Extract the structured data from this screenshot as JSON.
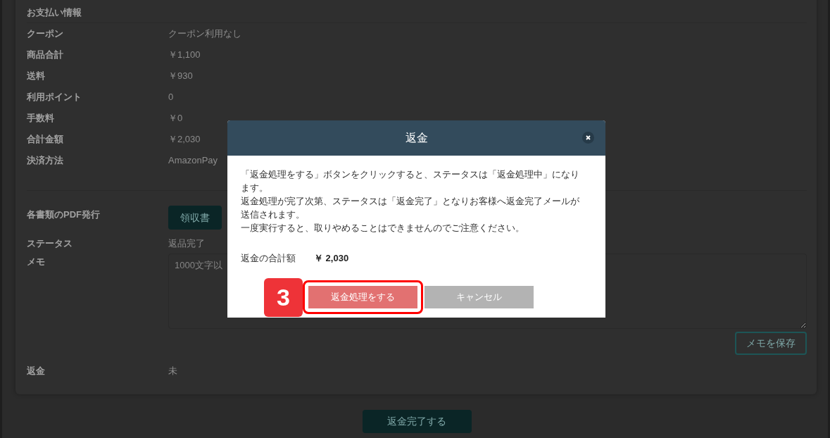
{
  "payment": {
    "title": "お支払い情報",
    "rows": [
      {
        "label": "クーポン",
        "value": "クーポン利用なし"
      },
      {
        "label": "商品合計",
        "value": "￥1,100"
      },
      {
        "label": "送料",
        "value": "￥930"
      },
      {
        "label": "利用ポイント",
        "value": "0"
      },
      {
        "label": "手数料",
        "value": "￥0"
      },
      {
        "label": "合計金額",
        "value": "￥2,030"
      },
      {
        "label": "決済方法",
        "value": "AmazonPay"
      }
    ]
  },
  "pdf": {
    "label": "各書類のPDF発行",
    "buttons": [
      "領収書"
    ]
  },
  "status": {
    "label": "ステータス",
    "value": "返品完了"
  },
  "memo": {
    "label": "メモ",
    "placeholder": "1000文字以",
    "save_button": "メモを保存"
  },
  "refund": {
    "label": "返金",
    "value": "未"
  },
  "complete_button": "返金完了する",
  "modal": {
    "title": "返金",
    "message_lines": [
      "「返金処理をする」ボタンをクリックすると、ステータスは「返金処理中」になり",
      "ます。",
      "返金処理が完了次第、ステータスは「返金完了」となりお客様へ返金完了メールが",
      "送信されます。",
      "一度実行すると、取りやめることはできませんのでご注意ください。"
    ],
    "total_label": "返金の合計額",
    "total_value": "￥ 2,030",
    "buttons": [
      {
        "label": "返金処理をする",
        "kind": "primary",
        "highlighted": true
      },
      {
        "label": "キャンセル",
        "kind": "cancel",
        "highlighted": false
      }
    ],
    "step_badge": "3"
  }
}
